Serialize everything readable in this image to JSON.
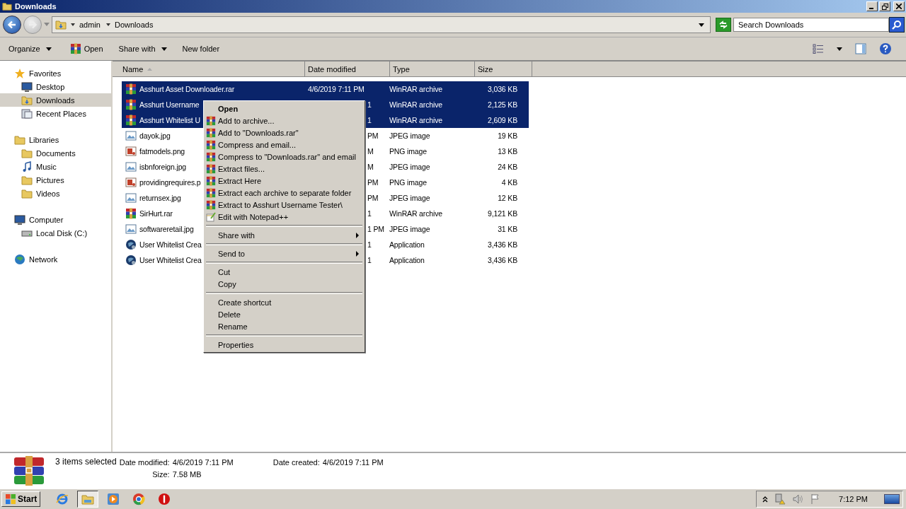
{
  "window": {
    "title": "Downloads"
  },
  "address": {
    "crumbs": [
      "admin",
      "Downloads"
    ],
    "search_placeholder": "Search Downloads"
  },
  "toolbar": [
    {
      "label": "Organize",
      "kind": "menu"
    },
    {
      "label": "Open",
      "kind": "rar"
    },
    {
      "label": "Share with",
      "kind": "menu"
    },
    {
      "label": "New folder",
      "kind": "plain"
    }
  ],
  "sidebar": {
    "groups": [
      {
        "label": "Favorites",
        "kind": "star",
        "children": [
          {
            "label": "Desktop",
            "kind": "desktop",
            "selected": false
          },
          {
            "label": "Downloads",
            "kind": "downloads",
            "selected": true
          },
          {
            "label": "Recent Places",
            "kind": "recent",
            "selected": false
          }
        ]
      },
      {
        "label": "Libraries",
        "kind": "library",
        "children": [
          {
            "label": "Documents",
            "kind": "docs",
            "selected": false
          },
          {
            "label": "Music",
            "kind": "music",
            "selected": false
          },
          {
            "label": "Pictures",
            "kind": "pictures",
            "selected": false
          },
          {
            "label": "Videos",
            "kind": "videos",
            "selected": false
          }
        ]
      },
      {
        "label": "Computer",
        "kind": "computer",
        "children": [
          {
            "label": "Local Disk (C:)",
            "kind": "disk",
            "selected": false
          }
        ]
      },
      {
        "label": "Network",
        "kind": "network"
      }
    ]
  },
  "table": {
    "columns": [
      "Name",
      "Date modified",
      "Type",
      "Size"
    ],
    "rows": [
      {
        "name": "Asshurt Asset Downloader.rar",
        "date": "4/6/2019 7:11 PM",
        "type": "WinRAR archive",
        "size": "3,036 KB",
        "kind": "rar",
        "selected": true,
        "date_cut": false
      },
      {
        "name": "Asshurt Username",
        "date": "1",
        "type": "WinRAR archive",
        "size": "2,125 KB",
        "kind": "rar",
        "selected": true,
        "date_cut": true
      },
      {
        "name": "Asshurt Whitelist U",
        "date": "1",
        "type": "WinRAR archive",
        "size": "2,609 KB",
        "kind": "rar",
        "selected": true,
        "date_cut": true
      },
      {
        "name": "dayok.jpg",
        "date": "PM",
        "type": "JPEG image",
        "size": "19 KB",
        "kind": "jpg",
        "selected": false,
        "date_cut": true
      },
      {
        "name": "fatmodels.png",
        "date": "M",
        "type": "PNG image",
        "size": "13 KB",
        "kind": "png",
        "selected": false,
        "date_cut": true
      },
      {
        "name": "isbnforeign.jpg",
        "date": "M",
        "type": "JPEG image",
        "size": "24 KB",
        "kind": "jpg",
        "selected": false,
        "date_cut": true
      },
      {
        "name": "providingrequires.p",
        "date": "PM",
        "type": "PNG image",
        "size": "4 KB",
        "kind": "png",
        "selected": false,
        "date_cut": true
      },
      {
        "name": "returnsex.jpg",
        "date": "PM",
        "type": "JPEG image",
        "size": "12 KB",
        "kind": "jpg",
        "selected": false,
        "date_cut": true
      },
      {
        "name": "SirHurt.rar",
        "date": "1",
        "type": "WinRAR archive",
        "size": "9,121 KB",
        "kind": "rar",
        "selected": false,
        "date_cut": true
      },
      {
        "name": "softwareretail.jpg",
        "date": "1 PM",
        "type": "JPEG image",
        "size": "31 KB",
        "kind": "jpg",
        "selected": false,
        "date_cut": true
      },
      {
        "name": "User Whitelist Crea",
        "date": "1",
        "type": "Application",
        "size": "3,436 KB",
        "kind": "app",
        "selected": false,
        "date_cut": true
      },
      {
        "name": "User Whitelist Crea",
        "date": "1",
        "type": "Application",
        "size": "3,436 KB",
        "kind": "app",
        "selected": false,
        "date_cut": true
      }
    ]
  },
  "context_menu": [
    {
      "label": "Open",
      "kind": "default"
    },
    {
      "label": "Add to archive...",
      "kind": "rar"
    },
    {
      "label": "Add to \"Downloads.rar\"",
      "kind": "rar"
    },
    {
      "label": "Compress and email...",
      "kind": "rar"
    },
    {
      "label": "Compress to \"Downloads.rar\" and email",
      "kind": "rar"
    },
    {
      "label": "Extract files...",
      "kind": "rar"
    },
    {
      "label": "Extract Here",
      "kind": "rar"
    },
    {
      "label": "Extract each archive to separate folder",
      "kind": "rar"
    },
    {
      "label": "Extract to Asshurt Username Tester\\",
      "kind": "rar"
    },
    {
      "label": "Edit with Notepad++",
      "kind": "notepad"
    },
    {
      "kind": "separator"
    },
    {
      "label": "Share with",
      "kind": "submenu"
    },
    {
      "kind": "separator"
    },
    {
      "label": "Send to",
      "kind": "submenu"
    },
    {
      "kind": "separator"
    },
    {
      "label": "Cut",
      "kind": "plain"
    },
    {
      "label": "Copy",
      "kind": "plain"
    },
    {
      "kind": "separator"
    },
    {
      "label": "Create shortcut",
      "kind": "plain"
    },
    {
      "label": "Delete",
      "kind": "plain"
    },
    {
      "label": "Rename",
      "kind": "plain"
    },
    {
      "kind": "separator"
    },
    {
      "label": "Properties",
      "kind": "plain"
    }
  ],
  "details": {
    "summary": "3 items selected",
    "modified_label": "Date modified:",
    "modified": "4/6/2019 7:11 PM",
    "size_label": "Size:",
    "size": "7.58 MB",
    "created_label": "Date created:",
    "created": "4/6/2019 7:11 PM"
  },
  "taskbar": {
    "start": "Start",
    "apps": [
      {
        "kind": "ie",
        "selected": false
      },
      {
        "kind": "explorer",
        "selected": true
      },
      {
        "kind": "media",
        "selected": false
      },
      {
        "kind": "chrome",
        "selected": false
      },
      {
        "kind": "stop",
        "selected": false
      }
    ],
    "clock": "7:12 PM"
  }
}
